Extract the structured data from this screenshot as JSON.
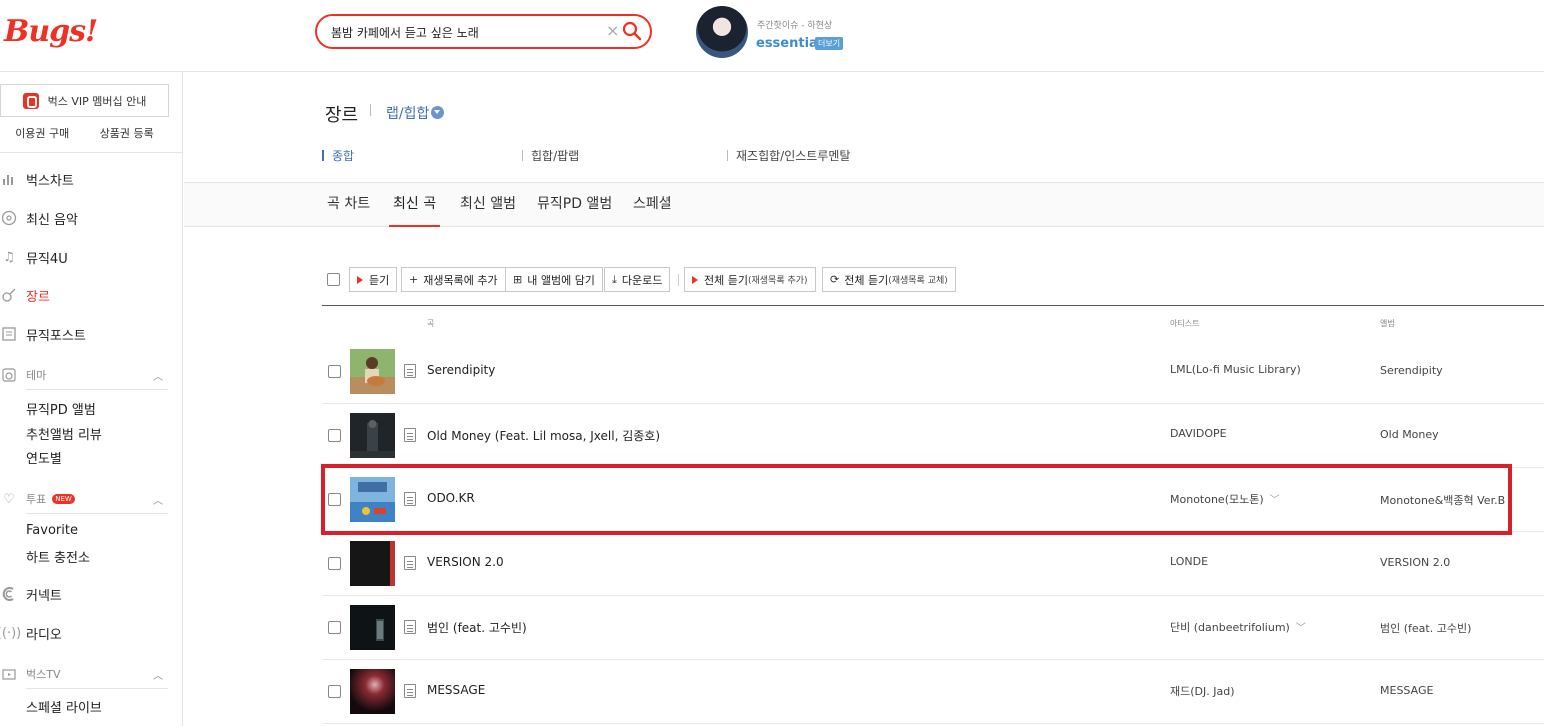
{
  "header": {
    "logo": "Bugs!",
    "search_value": "봄밤 카페에서 듣고 싶은 노래",
    "promo_subtitle": "주간핫이슈 - 하현상",
    "promo_title": "essential;",
    "promo_more": "더보기"
  },
  "sidebar": {
    "vip_label": "벅스 VIP 멤버십 안내",
    "sub_links": [
      "이용권 구매",
      "상품권 등록"
    ],
    "menu": {
      "chart": "벅스차트",
      "new_music": "최신 음악",
      "music4u": "뮤직4U",
      "genre": "장르",
      "musicpost": "뮤직포스트",
      "theme": "테마",
      "theme_items": [
        "뮤직PD 앨범",
        "추천앨범 리뷰",
        "연도별"
      ],
      "vote": "투표",
      "vote_badge": "NEW",
      "vote_items": [
        "Favorite",
        "하트 충전소"
      ],
      "connect": "커넥트",
      "radio": "라디오",
      "bugstv": "벅스TV",
      "bugstv_items": [
        "스페셜 라이브"
      ]
    }
  },
  "main": {
    "page_title": "장르",
    "genre_name": "랩/힙합",
    "subcategories": [
      "종합",
      "힙합/팝랩",
      "재즈힙합/인스트루멘탈"
    ],
    "tabs": [
      "곡 차트",
      "최신 곡",
      "최신 앨범",
      "뮤직PD 앨범",
      "스페셜"
    ],
    "active_tab": "최신 곡",
    "toolbar": {
      "play": "듣기",
      "add_playlist": "재생목록에 추가",
      "add_album": "내 앨범에 담기",
      "download": "다운로드",
      "play_all_add": "전체 듣기",
      "play_all_add_note": "(재생목록 추가)",
      "play_all_replace": "전체 듣기",
      "play_all_replace_note": "(재생목록 교체)"
    },
    "columns": {
      "song": "곡",
      "artist": "아티스트",
      "album": "앨범"
    },
    "songs": [
      {
        "title": "Serendipity",
        "artist": "LML(Lo-fi Music Library)",
        "album": "Serendipity"
      },
      {
        "title": "Old Money (Feat. Lil mosa, Jxell, 김종호)",
        "artist": "DAVIDOPE",
        "album": "Old Money"
      },
      {
        "title": "ODO.KR",
        "artist": "Monotone(모노톤)",
        "album": "Monotone&백종혁 Ver.B"
      },
      {
        "title": "VERSION 2.0",
        "artist": "LONDE",
        "album": "VERSION 2.0"
      },
      {
        "title": "범인 (feat. 고수빈)",
        "artist": "단비 (danbeetrifolium)",
        "album": "범인 (feat. 고수빈)"
      },
      {
        "title": "MESSAGE",
        "artist": "재드(DJ. Jad)",
        "album": "MESSAGE"
      }
    ]
  },
  "colors": {
    "brand_red": "#ef3124",
    "link_blue": "#3e6fb7",
    "highlight_red": "#d8202a"
  }
}
